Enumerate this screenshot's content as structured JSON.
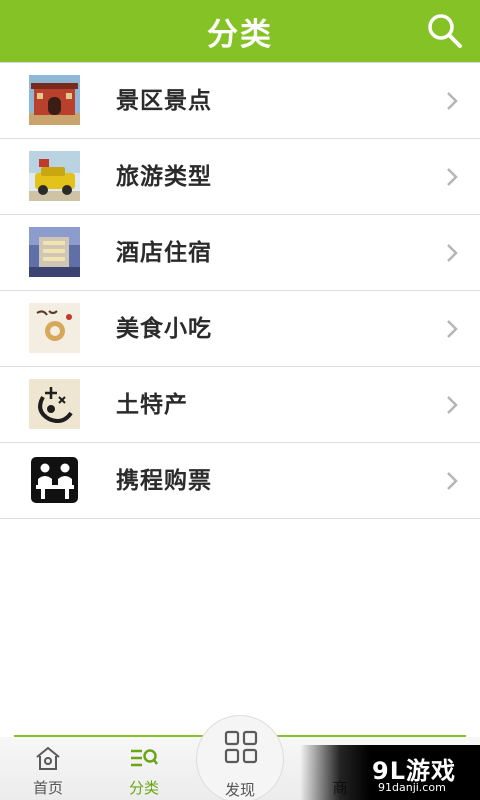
{
  "header": {
    "title": "分类",
    "search_icon": "search-icon"
  },
  "list": {
    "items": [
      {
        "label": "景区景点",
        "icon": "scenic-spot-thumbnail"
      },
      {
        "label": "旅游类型",
        "icon": "travel-type-thumbnail"
      },
      {
        "label": "酒店住宿",
        "icon": "hotel-thumbnail"
      },
      {
        "label": "美食小吃",
        "icon": "food-thumbnail"
      },
      {
        "label": "土特产",
        "icon": "local-specialty-thumbnail"
      },
      {
        "label": "携程购票",
        "icon": "ticket-counter-thumbnail"
      }
    ]
  },
  "tabbar": {
    "home": "首页",
    "category": "分类",
    "discover": "发现",
    "shop_partial": "商"
  },
  "watermark": {
    "main": "9L游戏",
    "sub": "91danji.com"
  },
  "colors": {
    "accent": "#85c226",
    "active_tab": "#6aa514"
  }
}
